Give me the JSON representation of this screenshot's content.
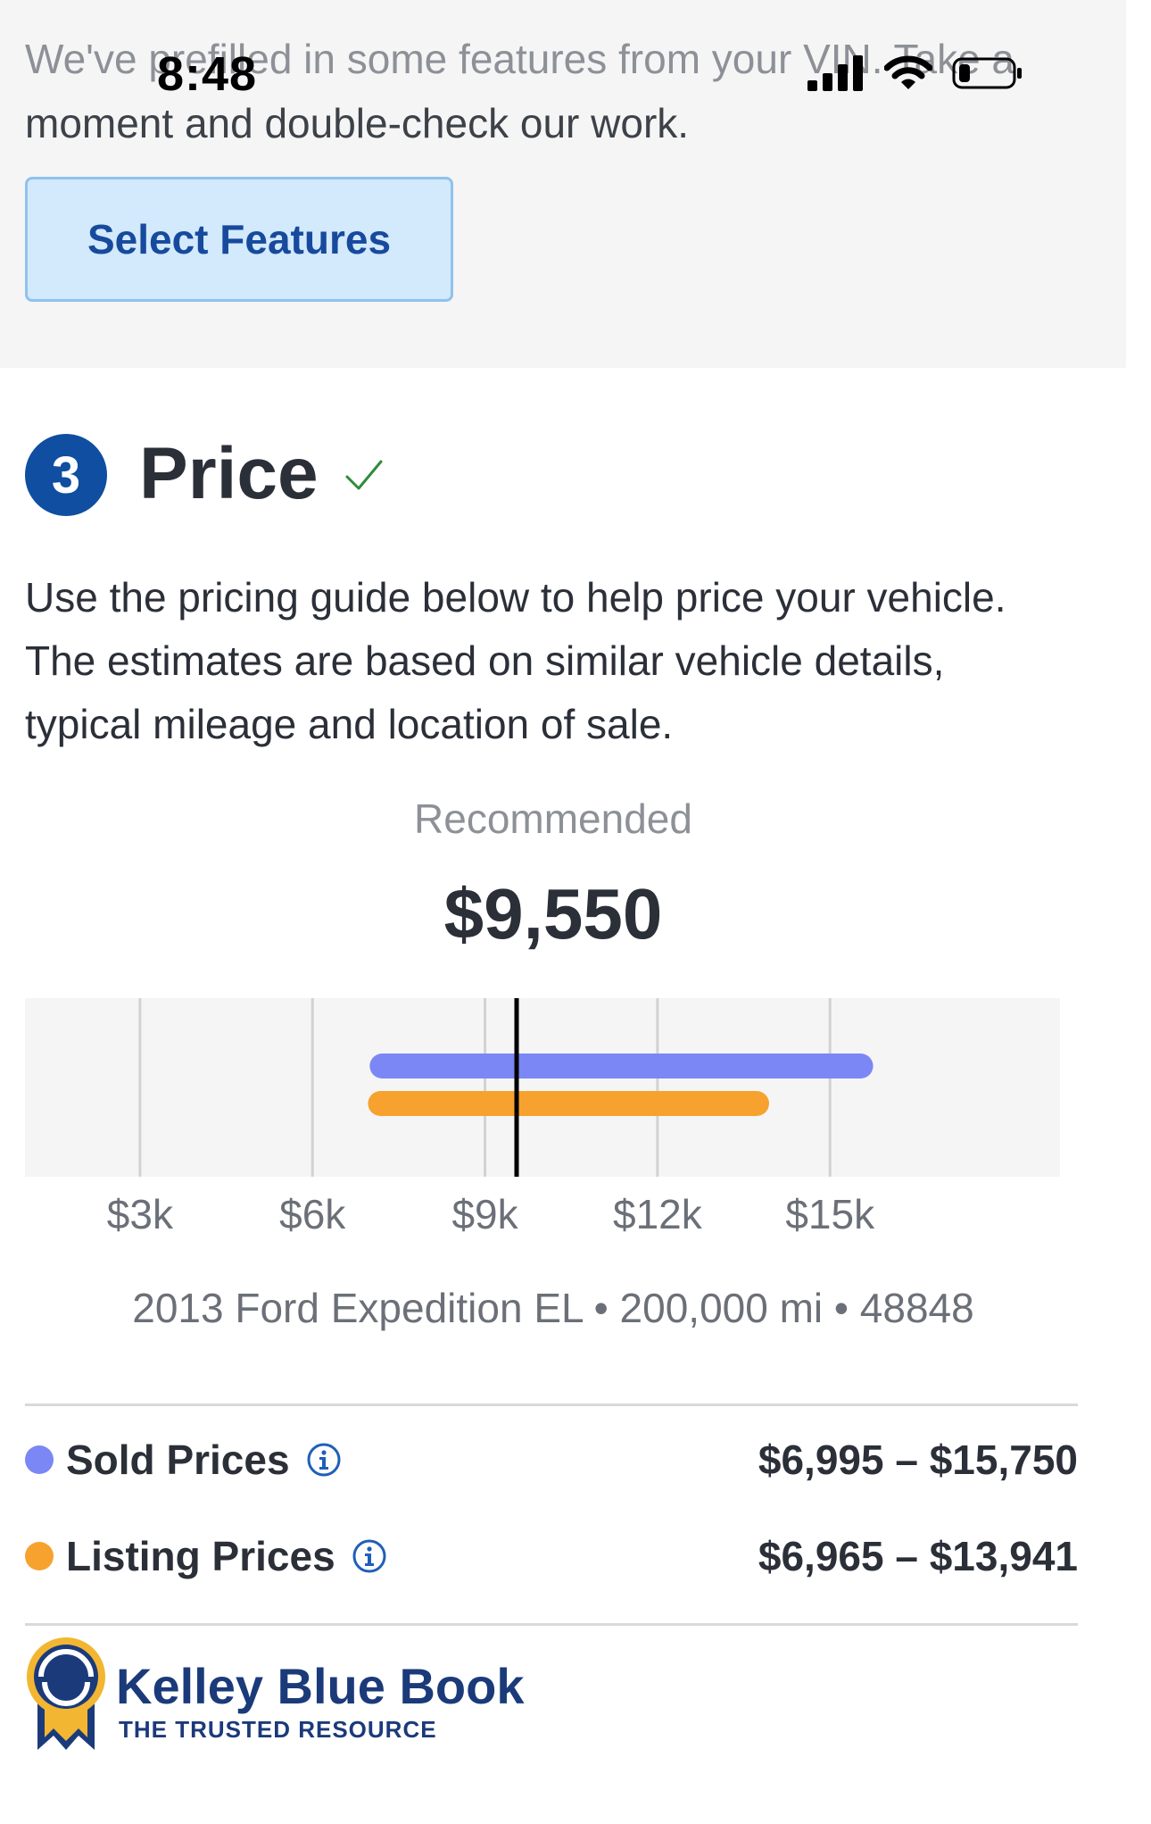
{
  "intro": {
    "line1": "We've prefilled in some features from your VIN. Take a",
    "line2": "moment and double-check our work."
  },
  "status_bar": {
    "time": "8:48",
    "icons": [
      "cellular-signal-icon",
      "wifi-icon",
      "battery-icon"
    ]
  },
  "select_features_label": "Select Features",
  "step": {
    "number": "3",
    "title": "Price",
    "status_icon": "check-icon"
  },
  "description": {
    "line1": "Use the pricing guide below to help price your vehicle.",
    "line2": "The estimates are based on similar vehicle details,",
    "line3": "typical mileage and location of sale."
  },
  "recommended": {
    "label": "Recommended",
    "price": "$9,550"
  },
  "chart_data": {
    "type": "bar",
    "orientation": "horizontal-range",
    "x_ticks": [
      "$3k",
      "$6k",
      "$9k",
      "$12k",
      "$15k"
    ],
    "x_tick_values": [
      3000,
      6000,
      9000,
      12000,
      15000
    ],
    "xlim": [
      1000,
      19000
    ],
    "marker_value": 9550,
    "series": [
      {
        "name": "Sold Prices",
        "low": 6995,
        "high": 15750,
        "color": "#7b87f5"
      },
      {
        "name": "Listing Prices",
        "low": 6965,
        "high": 13941,
        "color": "#f7a22f"
      }
    ],
    "grid": true
  },
  "vehicle_info": "2013 Ford Expedition EL • 200,000 mi • 48848",
  "legend": [
    {
      "label": "Sold Prices",
      "range": "$6,995 – $15,750",
      "color": "#7b87f5",
      "icon": "info-icon"
    },
    {
      "label": "Listing Prices",
      "range": "$6,965 – $13,941",
      "color": "#f7a22f",
      "icon": "info-icon"
    }
  ],
  "brand": {
    "name": "Kelley Blue Book",
    "tagline": "THE TRUSTED RESOURCE",
    "logo_icon": "kbb-ribbon-logo-icon"
  }
}
